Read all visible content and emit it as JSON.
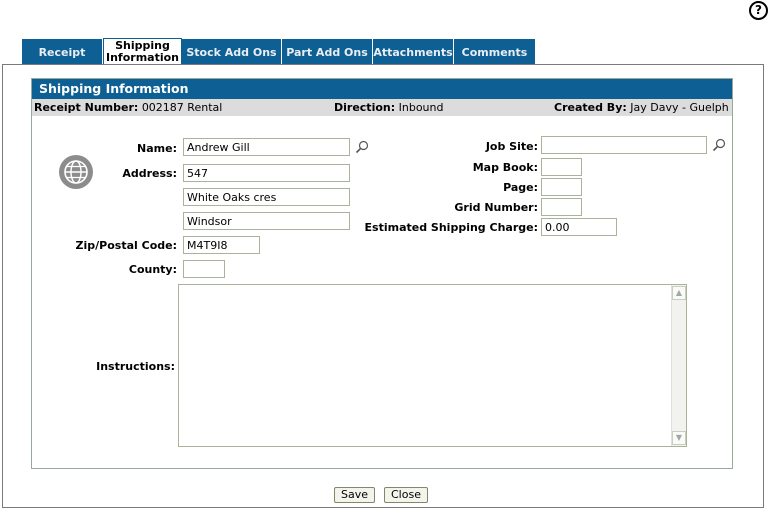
{
  "help": {
    "icon": "help-icon",
    "glyph": "?"
  },
  "tabs": [
    {
      "label": "Receipt"
    },
    {
      "label_line1": "Shipping",
      "label_line2": "Information",
      "active": true
    },
    {
      "label": "Stock Add Ons"
    },
    {
      "label": "Part Add Ons"
    },
    {
      "label": "Attachments"
    },
    {
      "label": "Comments"
    }
  ],
  "panel": {
    "title": "Shipping Information"
  },
  "info": {
    "receipt_label": "Receipt Number:",
    "receipt_value": "002187  Rental",
    "direction_label": "Direction:",
    "direction_value": "Inbound",
    "created_label": "Created By:",
    "created_value": "Jay Davy -  Guelph"
  },
  "form": {
    "name_label": "Name:",
    "name_value": "Andrew Gill",
    "address_label": "Address:",
    "address1": "547",
    "address2": "White Oaks cres",
    "address3": "Windsor",
    "zip_label": "Zip/Postal Code:",
    "zip_value": "M4T9I8",
    "county_label": "County:",
    "county_value": "",
    "instructions_label": "Instructions:",
    "instructions_value": "",
    "jobsite_label": "Job Site:",
    "jobsite_value": "",
    "mapbook_label": "Map Book:",
    "mapbook_value": "",
    "page_label": "Page:",
    "page_value": "",
    "grid_label": "Grid Number:",
    "grid_value": "",
    "charge_label": "Estimated Shipping Charge:",
    "charge_value": "0.00"
  },
  "buttons": {
    "save": "Save",
    "close": "Close"
  },
  "colors": {
    "tab_bg": "#0e5f93",
    "header_bg": "#0e5f93",
    "info_bg": "#dcdcdc"
  }
}
